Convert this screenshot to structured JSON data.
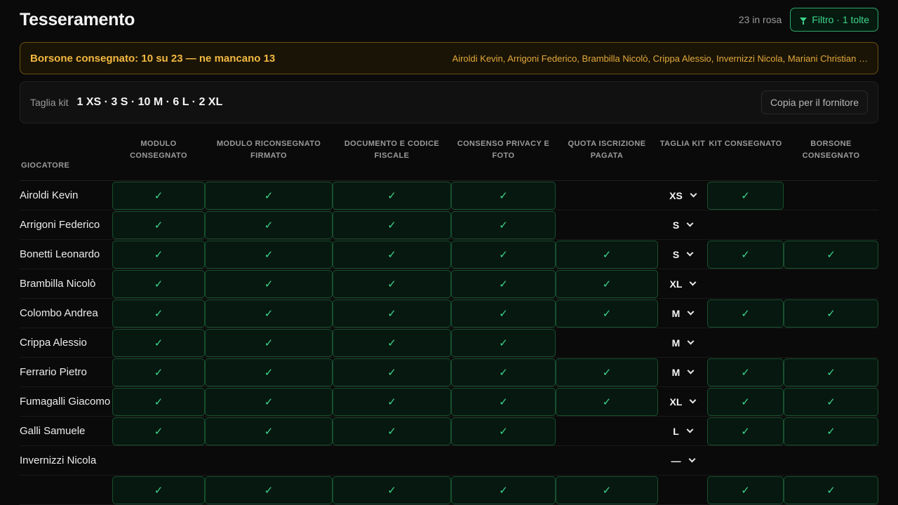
{
  "header": {
    "title": "Tesseramento",
    "count": "23 in rosa",
    "filter_label": "Filtro · 1 tolte"
  },
  "alert": {
    "title": "Borsone consegnato: 10 su 23 — ne mancano 13",
    "names": "Airoldi Kevin, Arrigoni Federico, Brambilla Nicolò, Crippa Alessio, Invernizzi Nicola, Mariani Christian …"
  },
  "kit": {
    "label": "Taglia kit",
    "summary": "1 XS · 3 S · 10 M · 6 L · 2 XL",
    "copy_label": "Copia per il fornitore"
  },
  "table": {
    "columns": [
      "Giocatore",
      "Modulo consegnato",
      "Modulo riconsegnato firmato",
      "Documento e codice fiscale",
      "Consenso privacy e foto",
      "Quota iscrizione pagata",
      "Taglia kit",
      "Kit consegnato",
      "Borsone consegnato"
    ],
    "check_glyph": "✓",
    "rows": [
      {
        "name": "Airoldi Kevin",
        "modulo": true,
        "firmato": true,
        "documento": true,
        "privacy": true,
        "quota": false,
        "taglia": "XS",
        "kit": true,
        "borsone": false
      },
      {
        "name": "Arrigoni Federico",
        "modulo": true,
        "firmato": true,
        "documento": true,
        "privacy": true,
        "quota": false,
        "taglia": "S",
        "kit": false,
        "borsone": false
      },
      {
        "name": "Bonetti Leonardo",
        "modulo": true,
        "firmato": true,
        "documento": true,
        "privacy": true,
        "quota": true,
        "taglia": "S",
        "kit": true,
        "borsone": true
      },
      {
        "name": "Brambilla Nicolò",
        "modulo": true,
        "firmato": true,
        "documento": true,
        "privacy": true,
        "quota": true,
        "taglia": "XL",
        "kit": false,
        "borsone": false
      },
      {
        "name": "Colombo Andrea",
        "modulo": true,
        "firmato": true,
        "documento": true,
        "privacy": true,
        "quota": true,
        "taglia": "M",
        "kit": true,
        "borsone": true
      },
      {
        "name": "Crippa Alessio",
        "modulo": true,
        "firmato": true,
        "documento": true,
        "privacy": true,
        "quota": false,
        "taglia": "M",
        "kit": false,
        "borsone": false
      },
      {
        "name": "Ferrario Pietro",
        "modulo": true,
        "firmato": true,
        "documento": true,
        "privacy": true,
        "quota": true,
        "taglia": "M",
        "kit": true,
        "borsone": true
      },
      {
        "name": "Fumagalli Giacomo",
        "modulo": true,
        "firmato": true,
        "documento": true,
        "privacy": true,
        "quota": true,
        "taglia": "XL",
        "kit": true,
        "borsone": true
      },
      {
        "name": "Galli Samuele",
        "modulo": true,
        "firmato": true,
        "documento": true,
        "privacy": true,
        "quota": false,
        "taglia": "L",
        "kit": true,
        "borsone": true
      },
      {
        "name": "Invernizzi Nicola",
        "modulo": false,
        "firmato": false,
        "documento": false,
        "privacy": false,
        "quota": false,
        "taglia": "—",
        "kit": false,
        "borsone": false
      },
      {
        "name": "",
        "modulo": true,
        "firmato": true,
        "documento": true,
        "privacy": true,
        "quota": true,
        "taglia": "",
        "kit": true,
        "borsone": true
      }
    ]
  },
  "colors": {
    "accent_green": "#3dd68c",
    "warning_amber": "#f4b942",
    "background": "#0a0a0a"
  }
}
